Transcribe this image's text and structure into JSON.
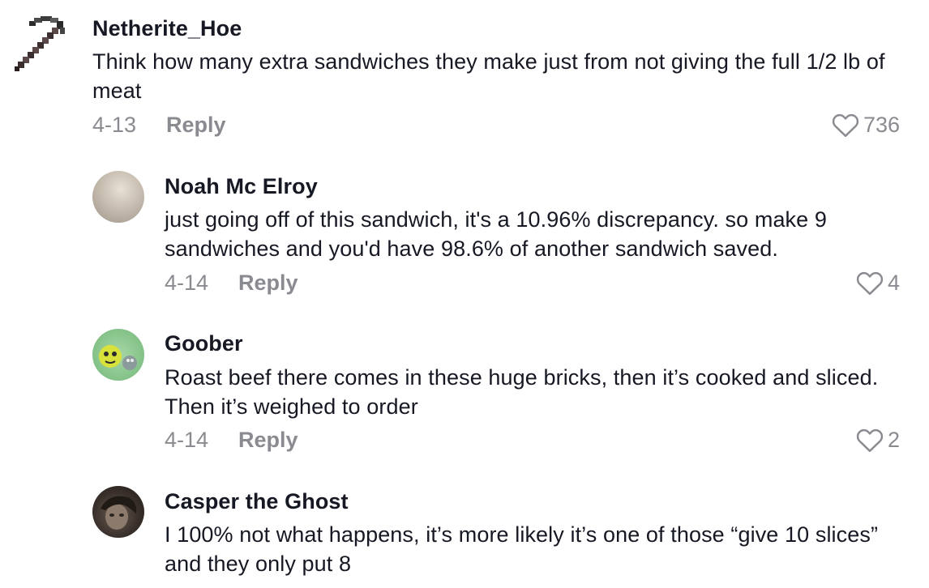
{
  "comments": [
    {
      "username": "Netherite_Hoe",
      "avatar_icon": "pickaxe-icon",
      "text": "Think how many extra sandwiches they make just from not giving the full 1/2 lb of meat",
      "date": "4-13",
      "reply_label": "Reply",
      "likes": "736"
    },
    {
      "username": "Noah Mc Elroy",
      "text": "just going off of this sandwich, it's a 10.96% discrepancy. so make 9 sandwiches and you'd have 98.6% of another sandwich saved.",
      "date": "4-14",
      "reply_label": "Reply",
      "likes": "4"
    },
    {
      "username": "Goober",
      "text": "Roast beef there comes in these huge bricks, then it’s cooked and sliced. Then it’s weighed to order",
      "date": "4-14",
      "reply_label": "Reply",
      "likes": "2"
    },
    {
      "username": "Casper the Ghost",
      "text": "I 100% not what happens, it’s more likely it’s one of those “give 10 slices” and they only put 8"
    }
  ],
  "colors": {
    "text": "#161823",
    "muted": "#8a8b91",
    "background": "#ffffff"
  }
}
